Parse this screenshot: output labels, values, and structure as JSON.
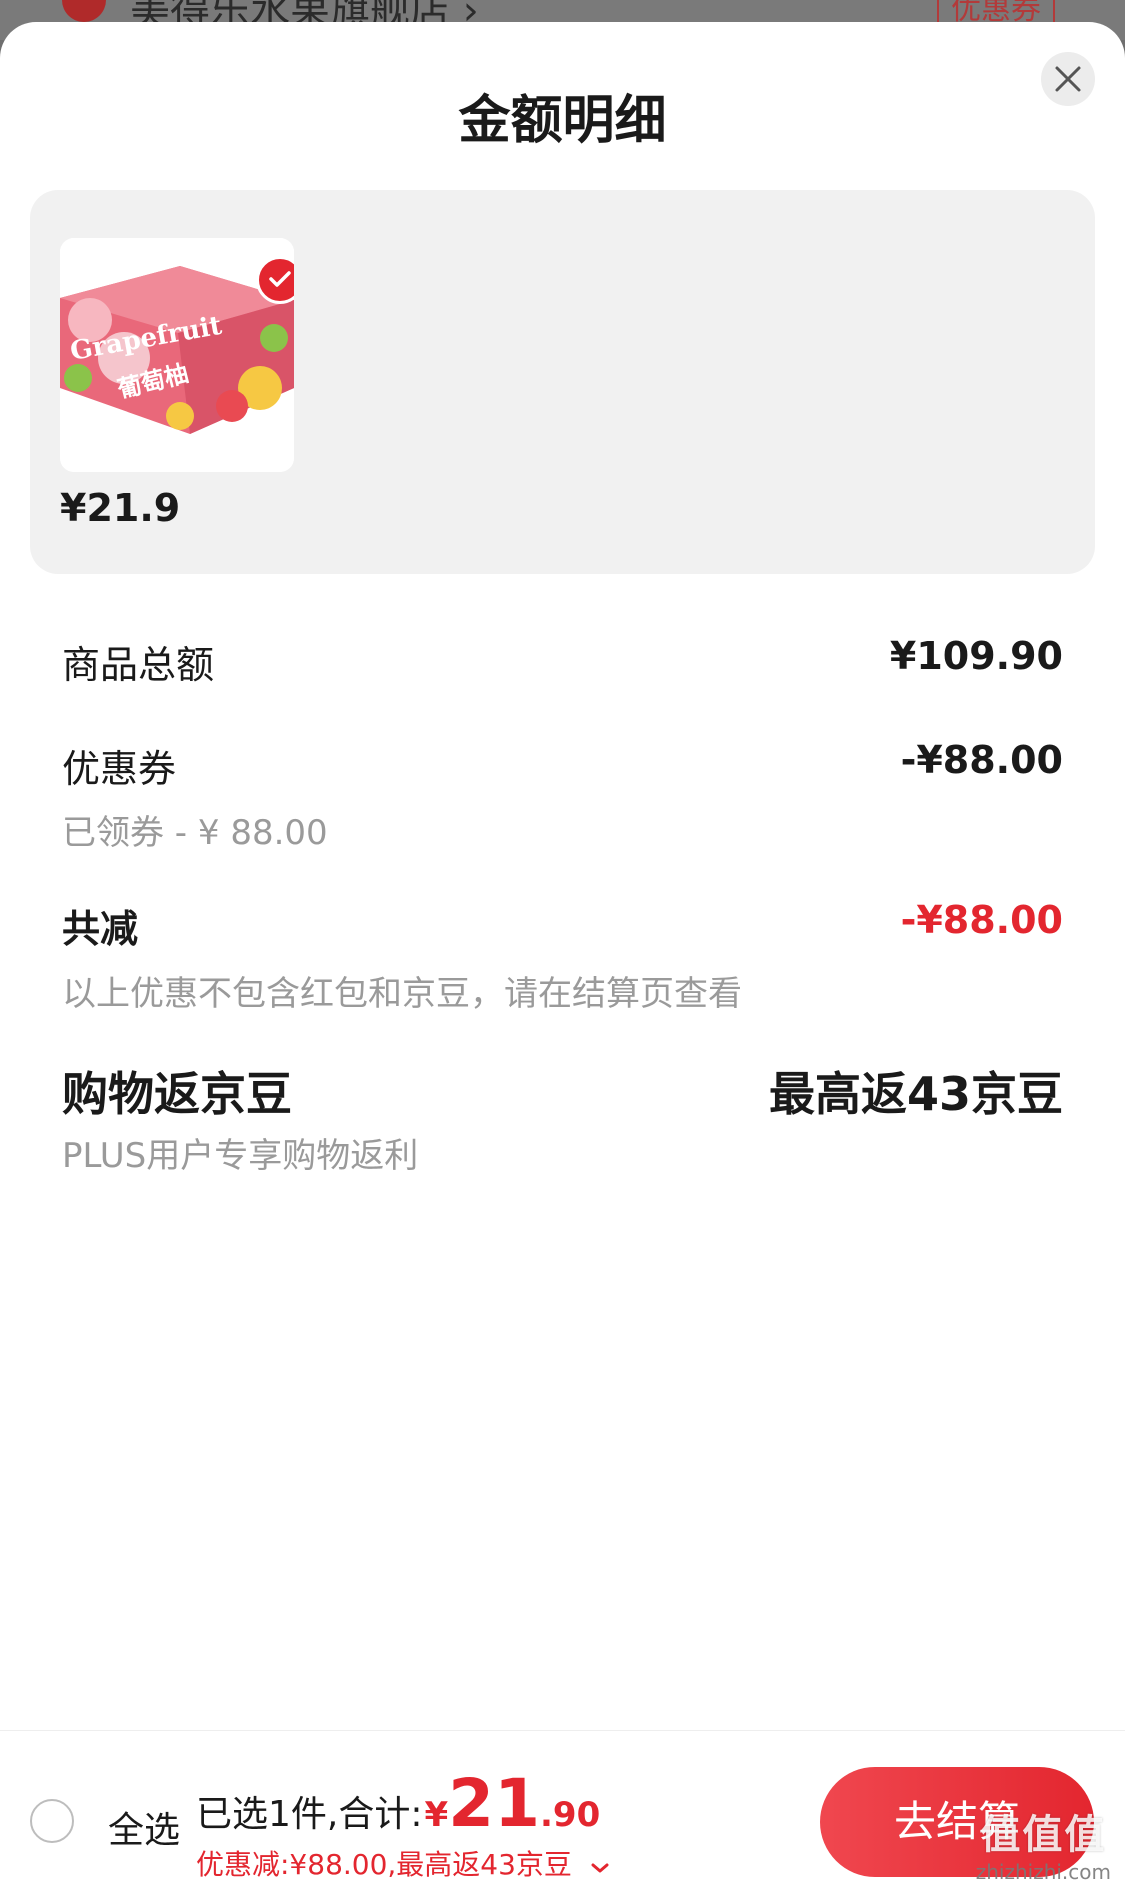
{
  "background": {
    "store_name": "美得乐水果旗舰店 ›",
    "coupon_tag": "优惠券"
  },
  "sheet": {
    "title": "金额明细",
    "close_icon": "close-icon"
  },
  "product": {
    "image_text_en": "Grapefruit",
    "image_text_cn": "葡萄柚",
    "price": "¥21.9",
    "selected": true
  },
  "rows": {
    "goods_total": {
      "label": "商品总额",
      "value": "¥109.90"
    },
    "coupon": {
      "label": "优惠券",
      "value": "-¥88.00",
      "sub": "已领券 - ¥ 88.00"
    },
    "total_reduction": {
      "label": "共减",
      "value": "-¥88.00",
      "sub": "以上优惠不包含红包和京豆，请在结算页查看"
    },
    "jingdou": {
      "label": "购物返京豆",
      "value": "最高返43京豆",
      "sub": "PLUS用户专享购物返利"
    }
  },
  "bottom_bar": {
    "select_all_label": "全选",
    "selected_summary": "已选1件,合计:",
    "currency": "¥",
    "total_int": "21",
    "total_dec": ".90",
    "discount_line": "优惠减:¥88.00,最高返43京豆",
    "checkout_label": "去结算"
  },
  "watermark": {
    "logo": "值值值",
    "url": "zhizhizhi.com"
  },
  "colors": {
    "accent_red": "#e3262f",
    "card_gray": "#f1f1f1",
    "sub_text": "#9a9a9a"
  }
}
